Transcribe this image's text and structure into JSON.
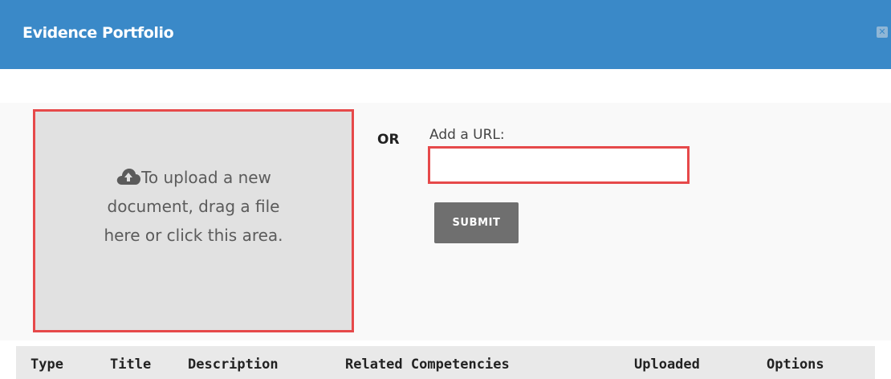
{
  "dialog": {
    "title": "Evidence Portfolio",
    "close_icon": "close-icon"
  },
  "upload": {
    "icon": "cloud-upload-icon",
    "line1": "To upload a new",
    "line2": "document, drag a file",
    "line3": "here or click this area."
  },
  "or_label": "OR",
  "url": {
    "label": "Add a URL:",
    "value": "",
    "placeholder": ""
  },
  "submit_label": "SUBMIT",
  "table": {
    "columns": [
      "Type",
      "Title",
      "Description",
      "Related Competencies",
      "Uploaded",
      "Options"
    ]
  },
  "colors": {
    "header_bg": "#3a89c8",
    "highlight_border": "#e6494a",
    "submit_bg": "#6f6f6f"
  }
}
